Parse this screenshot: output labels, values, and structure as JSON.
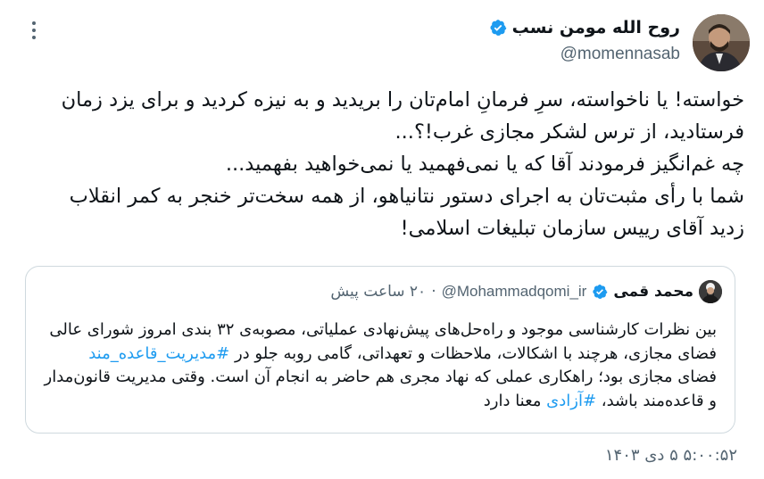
{
  "author": {
    "display_name": "روح الله مومن نسب",
    "handle": "@momennasab",
    "verified": true,
    "avatar_icon": "profile-photo"
  },
  "tweet_text_lines": [
    "خواسته! یا ناخواسته، سرِ فرمانِ امام‌تان را بریدید و به نیزه کردید و برای یزد زمان",
    "فرستادید، از ترس لشکر مجازی غرب!؟...",
    "چه غم‌انگیز فرمودند آقا که یا نمی‌فهمید یا نمی‌خواهید بفهمید...",
    "شما با رأی مثبت‌تان به اجرای دستور نتانیاهو، از همه سخت‌تر خنجر به کمر انقلاب",
    "زدید آقای رییس سازمان تبلیغات اسلامی!"
  ],
  "quoted_tweet": {
    "display_name": "محمد قمی",
    "handle": "@Mohammadqomi_ir",
    "separator": "·",
    "time": "۲۰ ساعت پیش",
    "verified": true,
    "line1": "بین نظرات کارشناسی موجود و راه‌حل‌های پیش‌نهادی عملیاتی، مصوبه‌ی ۳۲ بندی امروز شورای عالی",
    "line2_text": "فضای مجازی، هرچند با اشکالات، ملاحظات و تعهداتی، گامی روبه جلو در",
    "line2_hashtag": "#مدیریت_قاعده_مند",
    "line3": "فضای مجازی بود؛ راهکاری عملی که نهاد مجری هم حاضر به انجام آن است. وقتی مدیریت قانون‌مدار",
    "line4_text": "و قاعده‌مند باشد،",
    "line4_hashtag": "#آزادی",
    "line4_end": "معنا دارد"
  },
  "timestamp": "۵:۰۰:۵۲ ۵ دی ۱۴۰۳",
  "colors": {
    "text": "#0f1419",
    "secondary": "#536471",
    "link": "#1d9bf0",
    "verified": "#1d9bf0",
    "border": "#cfd9de"
  }
}
